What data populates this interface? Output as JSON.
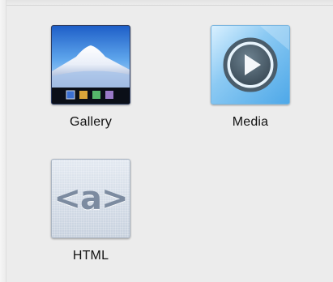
{
  "templates": [
    {
      "id": "gallery",
      "label": "Gallery",
      "icon": "gallery-icon"
    },
    {
      "id": "media",
      "label": "Media",
      "icon": "media-icon"
    },
    {
      "id": "html",
      "label": "HTML",
      "icon": "html-icon",
      "glyph": "<a>"
    }
  ],
  "colors": {
    "background": "#ececec",
    "label": "#111111",
    "gallery_swatches": [
      "#3b6fd1",
      "#d9a53a",
      "#55b86a",
      "#9a7ac8"
    ]
  }
}
